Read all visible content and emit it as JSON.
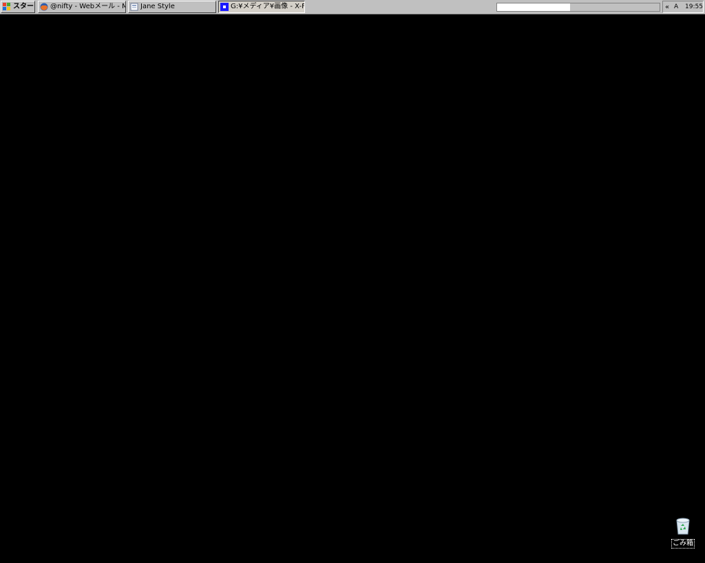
{
  "taskbar": {
    "start_label": "スタート",
    "tasks": [
      {
        "label": "@nifty - Webメール - Mo...",
        "icon": "firefox-icon"
      },
      {
        "label": "Jane Style",
        "icon": "jane-style-icon"
      },
      {
        "label": "G:¥メディア¥画像 - X-Fin...",
        "icon": "folder-window-icon"
      }
    ],
    "progress_fraction": 0.45,
    "tray": {
      "chevron": "«",
      "ime": "A",
      "clock": "19:55"
    }
  },
  "desktop": {
    "background_color": "#000000",
    "icons": [
      {
        "label": "ごみ箱",
        "icon": "recycle-bin-icon"
      }
    ]
  }
}
